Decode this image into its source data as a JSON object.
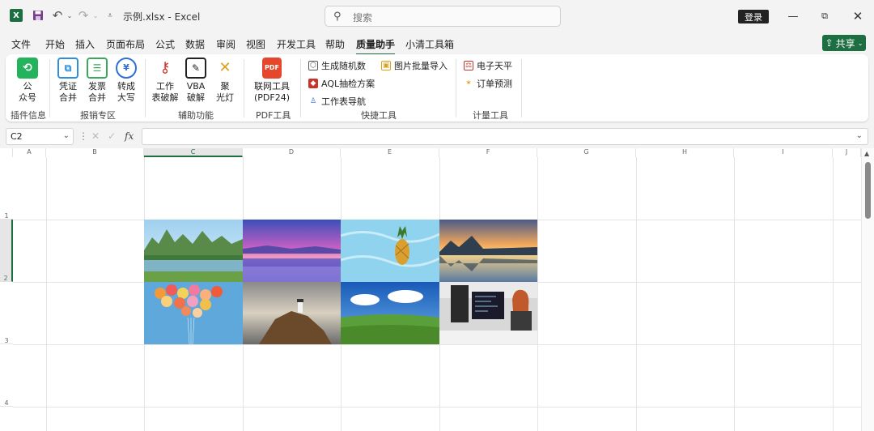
{
  "window": {
    "title": "示例.xlsx  -  Excel",
    "search_placeholder": "搜索",
    "login": "登录"
  },
  "tabs": [
    "文件",
    "开始",
    "插入",
    "页面布局",
    "公式",
    "数据",
    "审阅",
    "视图",
    "开发工具",
    "帮助",
    "质量助手",
    "小清工具箱"
  ],
  "active_tab": "质量助手",
  "share": "共享",
  "ribbon": {
    "gongzhonghao": "公\n众号",
    "pingzheng": "凭证\n合并",
    "fapiao": "发票\n合并",
    "zhuancheng": "转成\n大写",
    "gongzuobiao": "工作\n表破解",
    "vba": "VBA\n破解",
    "juguangdeng": "聚\n光灯",
    "lianwang": "联网工具\n(PDF24)",
    "shengcheng": "生成随机数",
    "aql": "AQL抽检方案",
    "daohang": "工作表导航",
    "tupian": "图片批量导入",
    "tianping": "电子天平",
    "dingdan": "订单预测",
    "pdf_badge": "PDF",
    "groups": {
      "plugin": "插件信息",
      "expense": "报销专区",
      "aux": "辅助功能",
      "pdf": "PDF工具",
      "quick": "快捷工具",
      "measure": "计量工具"
    }
  },
  "formula": {
    "namebox": "C2",
    "fx": "fx",
    "value": ""
  },
  "columns": [
    "A",
    "B",
    "C",
    "D",
    "E",
    "F",
    "G",
    "H",
    "I",
    "J"
  ],
  "rows": [
    "1",
    "2",
    "3",
    "4"
  ],
  "selected_col": "C",
  "selected_row": "2",
  "images": [
    "lake-mountains",
    "purple-sunset",
    "pineapple-water",
    "mountain-sunrise",
    "balloons",
    "lighthouse-cliff",
    "green-grassland",
    "office-woman"
  ]
}
